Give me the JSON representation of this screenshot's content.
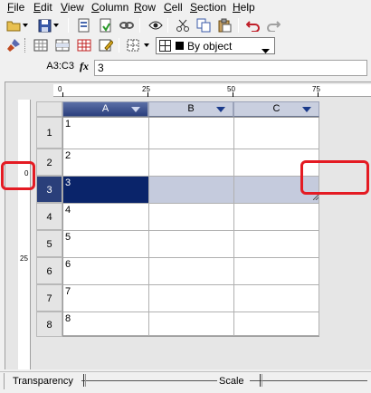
{
  "menu": [
    {
      "label": "File",
      "u": "F",
      "rest": "ile"
    },
    {
      "label": "Edit",
      "u": "E",
      "rest": "dit"
    },
    {
      "label": "View",
      "u": "V",
      "rest": "iew"
    },
    {
      "label": "Column",
      "u": "C",
      "rest": "olumn"
    },
    {
      "label": "Row",
      "u": "R",
      "rest": "ow"
    },
    {
      "label": "Cell",
      "u": "C",
      "rest": "ell"
    },
    {
      "label": "Section",
      "u": "S",
      "rest": "ection"
    },
    {
      "label": "Help",
      "u": "H",
      "rest": "elp"
    }
  ],
  "toolbar2": {
    "border_select_value": "By object"
  },
  "formula": {
    "cell_ref": "A3:C3",
    "fx": "fx",
    "value": "3"
  },
  "hruler": {
    "labels": [
      "0",
      "25",
      "50",
      "75"
    ]
  },
  "vruler": {
    "labels": [
      "0",
      "25"
    ]
  },
  "columns": [
    "A",
    "B",
    "C"
  ],
  "rows": [
    "1",
    "2",
    "3",
    "4",
    "5",
    "6",
    "7",
    "8"
  ],
  "cells_col_a": [
    "1",
    "2",
    "3",
    "4",
    "5",
    "6",
    "7",
    "8"
  ],
  "selected_row": "3",
  "status": {
    "transparency_label": "Transparency",
    "scale_label": "Scale"
  },
  "colors": {
    "selection": "#0a246a",
    "highlight_box": "#e41b23"
  }
}
